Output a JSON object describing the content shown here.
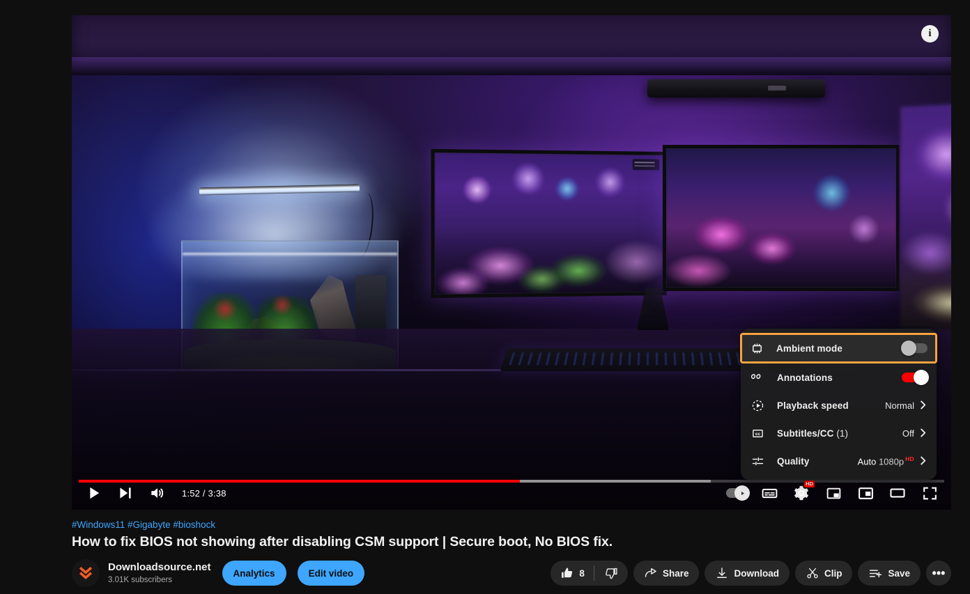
{
  "player": {
    "info_icon": "info-icon",
    "current_time": "1:52",
    "total_time": "3:38",
    "time_display": "1:52 / 3:38",
    "progress_percent": 51,
    "buffered_percent": 73,
    "controls": {
      "play_label": "Play",
      "next_label": "Next",
      "volume_label": "Mute",
      "autoplay_label": "Autoplay",
      "subtitles_label": "Subtitles/CC",
      "settings_label": "Settings",
      "settings_badge": "HD",
      "miniplayer_label": "Miniplayer",
      "pip_label": "Picture in picture",
      "theater_label": "Theater mode",
      "fullscreen_label": "Full screen"
    }
  },
  "settings_menu": {
    "items": [
      {
        "id": "ambient-mode",
        "icon": "ambient-mode-icon",
        "label": "Ambient mode",
        "control": "toggle",
        "toggle_on": false,
        "highlighted": true
      },
      {
        "id": "annotations",
        "icon": "annotations-icon",
        "label": "Annotations",
        "control": "toggle",
        "toggle_on": true,
        "highlighted": false
      },
      {
        "id": "playback-speed",
        "icon": "playback-speed-icon",
        "label": "Playback speed",
        "control": "submenu",
        "value": "Normal",
        "highlighted": false
      },
      {
        "id": "subtitles-cc",
        "icon": "subtitles-icon",
        "label": "Subtitles/CC",
        "label_suffix": "(1)",
        "control": "submenu",
        "value": "Off",
        "highlighted": false
      },
      {
        "id": "quality",
        "icon": "quality-icon",
        "label": "Quality",
        "control": "submenu",
        "value": "Auto",
        "value_secondary": "1080p",
        "value_badge": "HD",
        "highlighted": false
      }
    ],
    "highlight_color": "#f6a33f",
    "toggle_on_color": "#ff0000"
  },
  "video_meta": {
    "hashtags": "#Windows11 #Gigabyte #bioshock",
    "title": "How to fix BIOS not showing after disabling CSM support | Secure boot, No BIOS fix."
  },
  "channel": {
    "avatar_icon": "double-chevron-logo",
    "name": "Downloadsource.net",
    "subscribers": "3.01K subscribers",
    "analytics_label": "Analytics",
    "edit_video_label": "Edit video"
  },
  "actions": {
    "like_count": "8",
    "like_label": "Like",
    "dislike_label": "Dislike",
    "share_label": "Share",
    "download_label": "Download",
    "clip_label": "Clip",
    "save_label": "Save",
    "more_label": "•••"
  },
  "colors": {
    "background": "#0f0f0f",
    "accent_blue": "#3ea6ff",
    "youtube_red": "#ff0000",
    "highlight_orange": "#f6a33f",
    "pill_background": "#272727"
  }
}
